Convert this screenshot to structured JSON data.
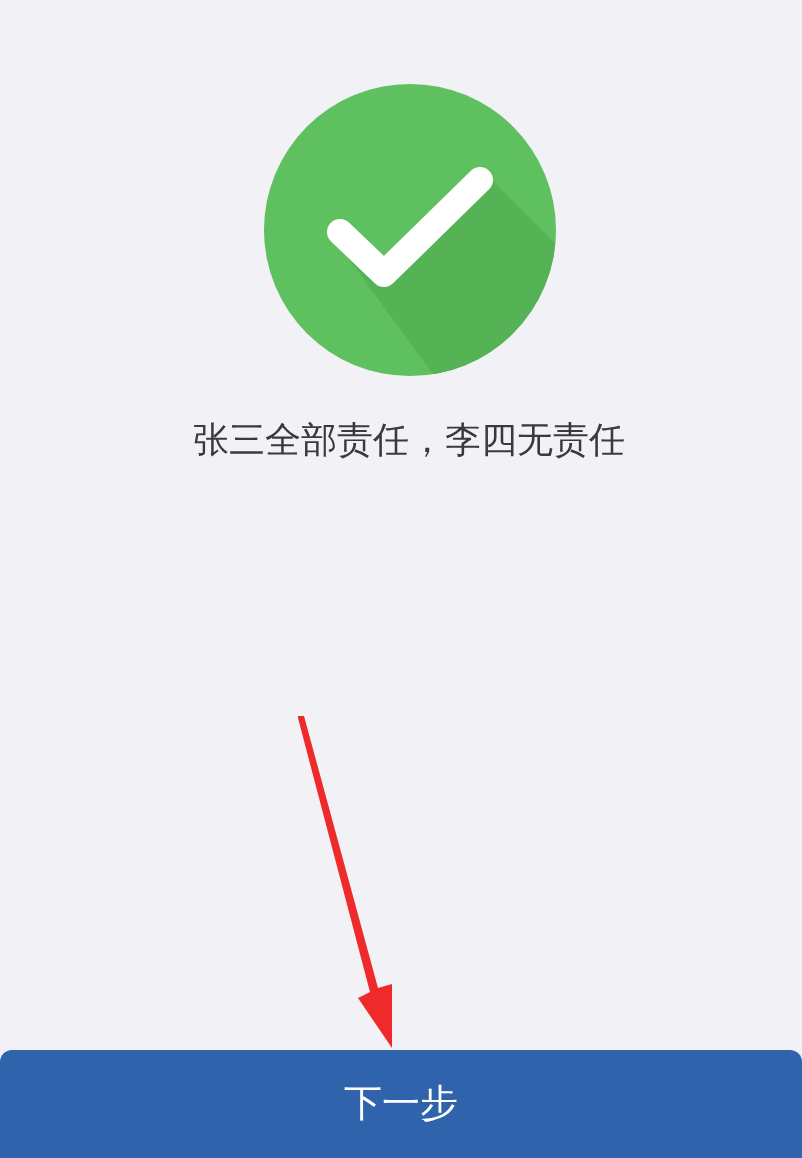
{
  "result": {
    "message": "张三全部责任，李四无责任"
  },
  "next_button": {
    "label": "下一步"
  }
}
